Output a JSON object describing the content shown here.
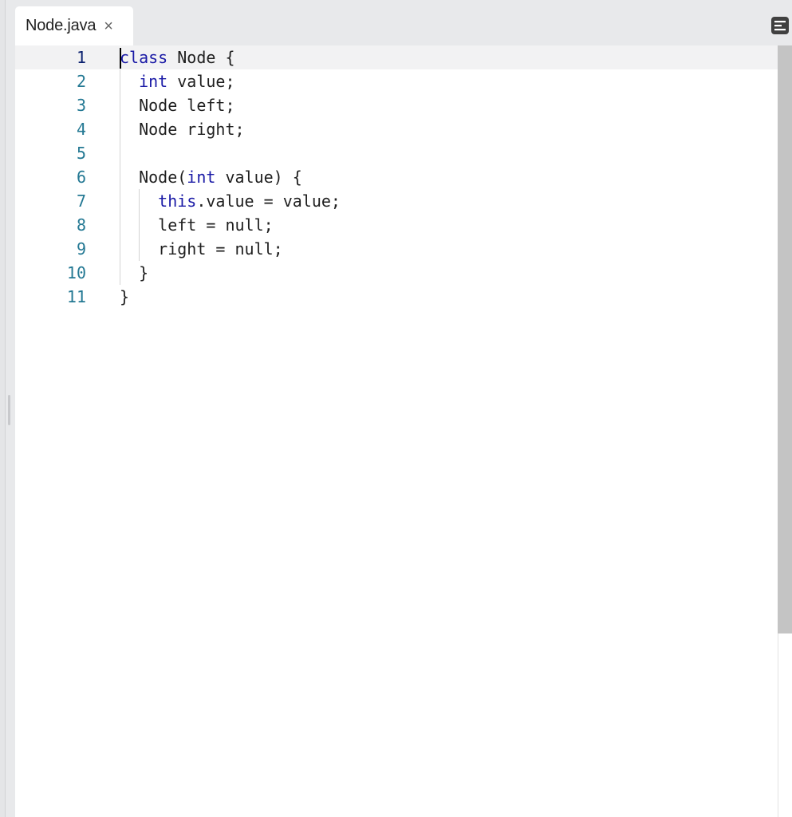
{
  "tab": {
    "title": "Node.java",
    "close_glyph": "×",
    "close_icon": "close-icon"
  },
  "toolbar": {
    "minimap_icon": "minimap-toggle-icon"
  },
  "editor": {
    "language": "java",
    "lines": [
      {
        "num": "1",
        "text": "class Node {"
      },
      {
        "num": "2",
        "text": "  int value;"
      },
      {
        "num": "3",
        "text": "  Node left;"
      },
      {
        "num": "4",
        "text": "  Node right;"
      },
      {
        "num": "5",
        "text": ""
      },
      {
        "num": "6",
        "text": "  Node(int value) {"
      },
      {
        "num": "7",
        "text": "    this.value = value;"
      },
      {
        "num": "8",
        "text": "    left = null;"
      },
      {
        "num": "9",
        "text": "    right = null;"
      },
      {
        "num": "10",
        "text": "  }"
      },
      {
        "num": "11",
        "text": "}"
      }
    ],
    "active_line": 1
  },
  "colors": {
    "keyword": "#1a1aa6",
    "line_number": "#237893",
    "active_line_number": "#0b216f",
    "active_line_bg": "#f2f2f3"
  }
}
